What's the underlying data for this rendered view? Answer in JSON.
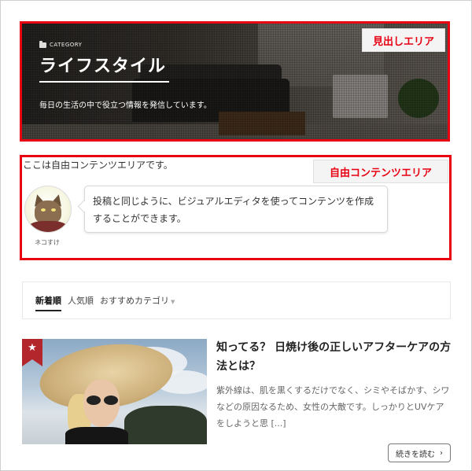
{
  "header": {
    "category_label": "CATEGORY",
    "title": "ライフスタイル",
    "description": "毎日の生活の中で役立つ情報を発信しています。",
    "area_tag": "見出しエリア"
  },
  "free_area": {
    "text": "ここは自由コンテンツエリアです。",
    "area_tag": "自由コンテンツエリア",
    "speech": {
      "author_name": "ネコすけ",
      "text": "投稿と同じように、ビジュアルエディタを使ってコンテンツを作成することができます。"
    }
  },
  "tabs": {
    "items": [
      {
        "label": "新着順"
      },
      {
        "label": "人気順"
      },
      {
        "label": "おすすめカテゴリ"
      }
    ]
  },
  "article": {
    "ribbon_icon": "★",
    "title": "知ってる？ 日焼け後の正しいアフターケアの方法とは？",
    "excerpt": "紫外線は、肌を黒くするだけでなく、シミやそばかす、シワなどの原因なるため、女性の大敵です。しっかりとUVケアをしようと思 [...]",
    "read_more": "続きを読む",
    "read_more_arrow": "›"
  },
  "colors": {
    "highlight_border": "#e60012",
    "ribbon": "#b3262b"
  }
}
